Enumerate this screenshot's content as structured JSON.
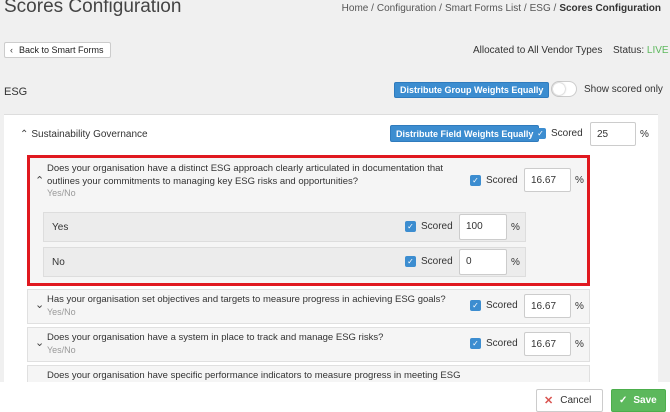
{
  "page": {
    "title": "Scores Configuration",
    "breadcrumb": [
      "Home /",
      "Configuration /",
      "Smart Forms List /",
      "ESG /",
      "Scores Configuration"
    ]
  },
  "toolbar": {
    "back_label": "Back to Smart Forms",
    "allocated_text": "Allocated to All Vendor Types",
    "status_label": "Status:",
    "status_value": "LIVE"
  },
  "section": {
    "title": "ESG",
    "distribute_groups_label": "Distribute Group Weights Equally",
    "show_scored_label": "Show scored only",
    "show_scored_on": false
  },
  "group": {
    "title": "Sustainability Governance",
    "distribute_fields_label": "Distribute Field Weights Equally",
    "scored_label": "Scored",
    "weight": "25",
    "pct": "%"
  },
  "questions": [
    {
      "text_line1": "Does your organisation have a distinct ESG approach clearly articulated in documentation that",
      "text_line2": "outlines your commitments to managing key ESG risks and opportunities?",
      "type": "Yes/No",
      "scored_label": "Scored",
      "weight": "16.67",
      "pct": "%",
      "options": [
        {
          "label": "Yes",
          "scored_label": "Scored",
          "value": "100",
          "pct": "%"
        },
        {
          "label": "No",
          "scored_label": "Scored",
          "value": "0",
          "pct": "%"
        }
      ]
    },
    {
      "text": "Has your organisation set objectives and targets to measure progress in achieving ESG goals?",
      "type": "Yes/No",
      "scored_label": "Scored",
      "weight": "16.67",
      "pct": "%"
    },
    {
      "text": "Does your organisation have a system in place to track and manage ESG risks?",
      "type": "Yes/No",
      "scored_label": "Scored",
      "weight": "16.67",
      "pct": "%"
    },
    {
      "text": "Does your organisation have specific performance indicators to measure progress in meeting ESG"
    }
  ],
  "footer": {
    "cancel_label": "Cancel",
    "save_label": "Save"
  },
  "colors": {
    "accent": "#3c8dd0",
    "live": "#5cb85c",
    "highlight": "#e0181f",
    "save": "#5cb85c"
  }
}
